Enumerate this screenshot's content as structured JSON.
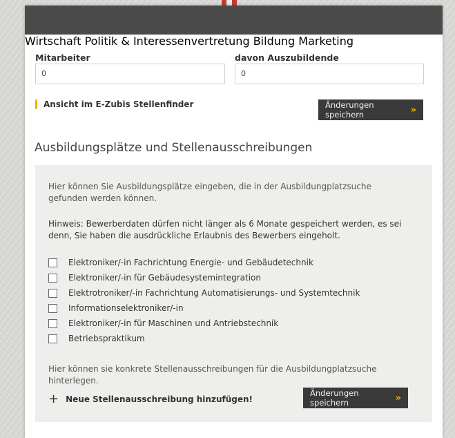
{
  "nav": {
    "items": [
      "Wirtschaft",
      "Politik & Interessenvertretung",
      "Bildung",
      "Marketing"
    ]
  },
  "employees": {
    "mitarbeiter_label": "Mitarbeiter",
    "mitarbeiter_value": "0",
    "azubi_label": "davon Auszubildende",
    "azubi_value": "0"
  },
  "view_link": "Ansicht im E-Zubis Stellenfinder",
  "save_button": "Änderungen speichern",
  "section_title": "Ausbildungsplätze und Stellenausschreibungen",
  "info_text": "Hier können Sie Ausbildungsplätze eingeben, die in der Ausbildungplatzsuche gefunden werden können.",
  "hint_text": "Hinweis: Bewerberdaten dürfen nicht länger als 6 Monate gespeichert werden, es sei denn, Sie haben die ausdrückliche Erlaubnis des Bewerbers eingeholt.",
  "positions": [
    {
      "label": "Elektroniker/-in Fachrichtung Energie- und Gebäudetechnik",
      "checked": false
    },
    {
      "label": "Elektroniker/-in für Gebäudesystemintegration",
      "checked": false
    },
    {
      "label": "Elektrotroniker/-in Fachrichtung Automatisierungs- und Systemtechnik",
      "checked": false
    },
    {
      "label": "Informationselektroniker/-in",
      "checked": false
    },
    {
      "label": "Elektroniker/-in für Maschinen und Antriebstechnik",
      "checked": false
    },
    {
      "label": "Betriebspraktikum",
      "checked": false
    }
  ],
  "listing_text": "Hier können sie konkrete Stellenausschreibungen für die Ausbildungplatzsuche hinterlegen.",
  "add_listing": "Neue Stellenausschreibung hinzufügen!",
  "icons": {
    "arrow": "double-chevron-right-icon",
    "plus": "plus-icon"
  },
  "colors": {
    "accent": "#f0b400",
    "nav_bg": "#4a4a4a",
    "button_bg": "#3a3a3a",
    "box_bg": "#eeeeec"
  }
}
